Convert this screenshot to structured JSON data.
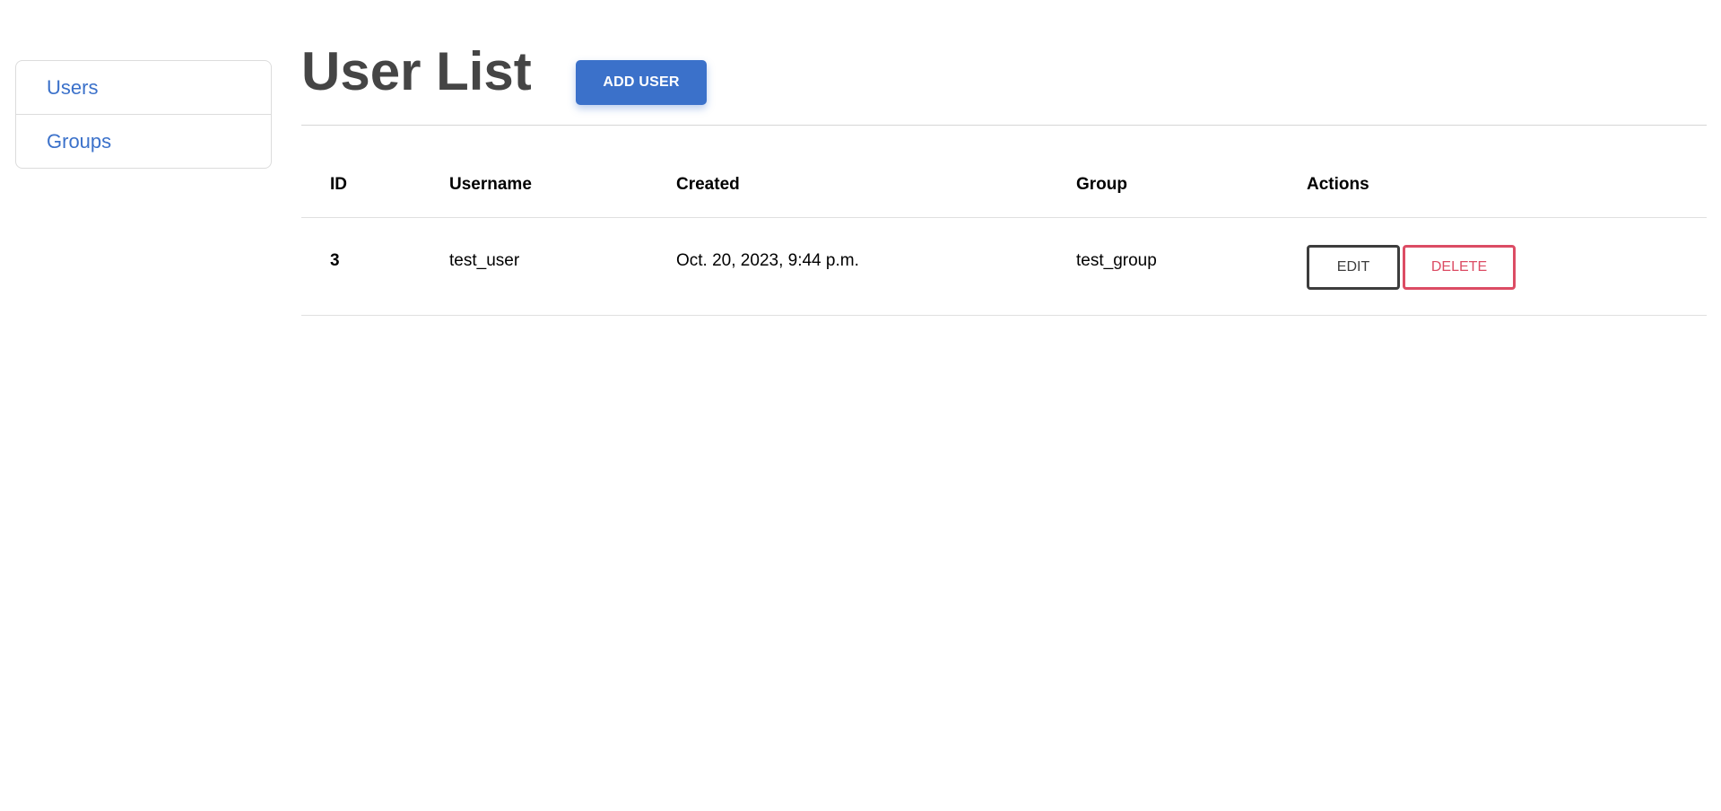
{
  "colors": {
    "primary": "#3b71ca",
    "link": "#3b71ca",
    "danger": "#dc4c64",
    "title": "#454545"
  },
  "sidebar": {
    "items": [
      {
        "label": "Users"
      },
      {
        "label": "Groups"
      }
    ]
  },
  "header": {
    "title": "User List",
    "add_user_label": "ADD USER"
  },
  "table": {
    "columns": [
      "ID",
      "Username",
      "Created",
      "Group",
      "Actions"
    ],
    "rows": [
      {
        "id": "3",
        "username": "test_user",
        "created": "Oct. 20, 2023, 9:44 p.m.",
        "group": "test_group",
        "edit_label": "EDIT",
        "delete_label": "DELETE"
      }
    ]
  }
}
